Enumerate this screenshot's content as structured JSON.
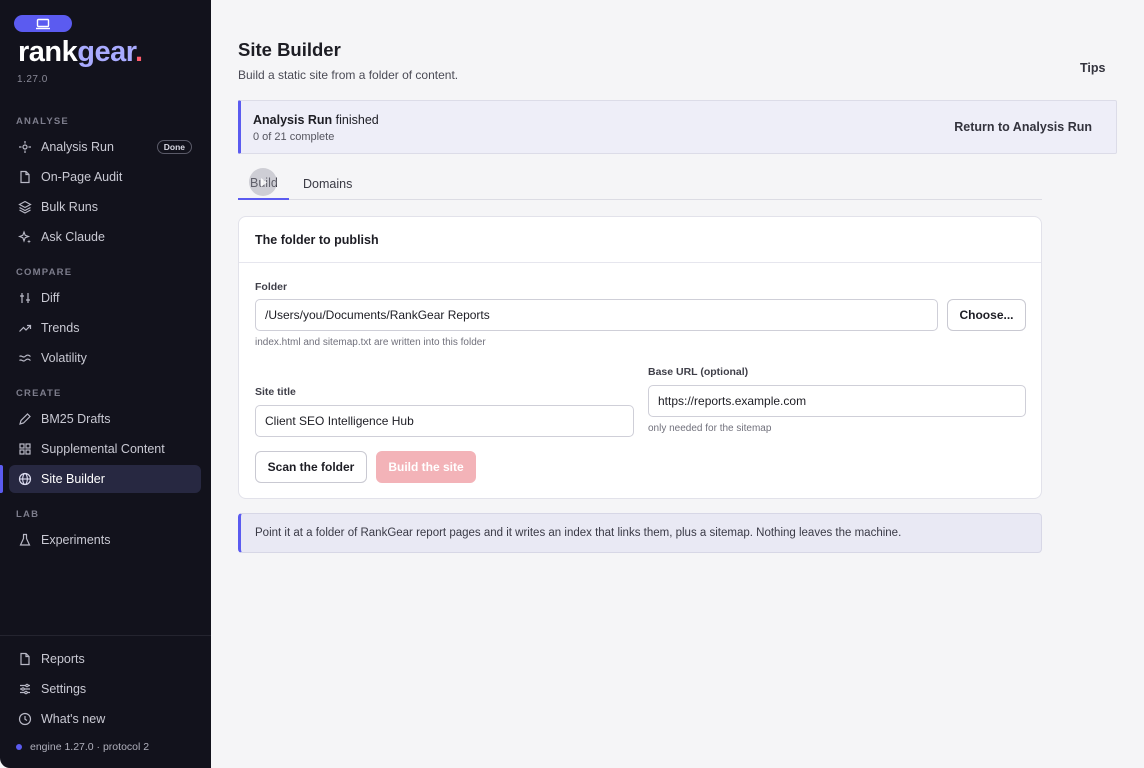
{
  "brand": {
    "part1": "rank",
    "part2": "gear",
    "part3": ".",
    "version": "1.27.0"
  },
  "sidebar": {
    "sections": [
      {
        "label": "ANALYSE"
      },
      {
        "label": "COMPARE"
      },
      {
        "label": "CREATE"
      },
      {
        "label": "LAB"
      }
    ],
    "items": [
      {
        "label": "Analysis Run",
        "icon": "sparkle-icon",
        "badge": "Done"
      },
      {
        "label": "On-Page Audit",
        "icon": "document-icon"
      },
      {
        "label": "Bulk Runs",
        "icon": "layers-icon"
      },
      {
        "label": "Ask Claude",
        "icon": "sparkles-icon"
      },
      {
        "label": "Diff",
        "icon": "diff-icon"
      },
      {
        "label": "Trends",
        "icon": "trend-up-icon"
      },
      {
        "label": "Volatility",
        "icon": "wave-icon"
      },
      {
        "label": "BM25 Drafts",
        "icon": "pencil-icon"
      },
      {
        "label": "Supplemental Content",
        "icon": "grid-icon"
      },
      {
        "label": "Site Builder",
        "icon": "globe-icon",
        "active": true
      },
      {
        "label": "Experiments",
        "icon": "flask-icon"
      }
    ],
    "footer_items": [
      {
        "label": "Reports",
        "icon": "document-icon"
      },
      {
        "label": "Settings",
        "icon": "sliders-icon"
      },
      {
        "label": "What's new",
        "icon": "clock-icon"
      }
    ],
    "engine_status": "engine 1.27.0 · protocol 2"
  },
  "header": {
    "title": "Site Builder",
    "subtitle": "Build a static site from a folder of content.",
    "tips": "Tips"
  },
  "banner": {
    "title_bold": "Analysis Run",
    "title_rest": " finished",
    "progress": "0 of 21 complete",
    "link": "Return to Analysis Run"
  },
  "tabs": [
    {
      "label": "Build",
      "active": true
    },
    {
      "label": "Domains"
    }
  ],
  "card": {
    "title": "The folder to publish",
    "folder_label": "Folder",
    "folder_value": "/Users/you/Documents/RankGear Reports",
    "choose_label": "Choose...",
    "folder_hint": "index.html and sitemap.txt are written into this folder",
    "site_title_label": "Site title",
    "site_title_value": "Client SEO Intelligence Hub",
    "base_url_label": "Base URL (optional)",
    "base_url_value": "https://reports.example.com",
    "base_url_hint": "only needed for the sitemap",
    "scan_label": "Scan the folder",
    "build_label": "Build the site"
  },
  "info": "Point it at a folder of RankGear report pages and it writes an index that links them, plus a sitemap. Nothing leaves the machine.",
  "colors": {
    "accent": "#5b5bf0",
    "sidebar_bg": "#12121c",
    "brand_dot": "#ff5c6c",
    "disabled_primary": "#f3b3b8"
  }
}
